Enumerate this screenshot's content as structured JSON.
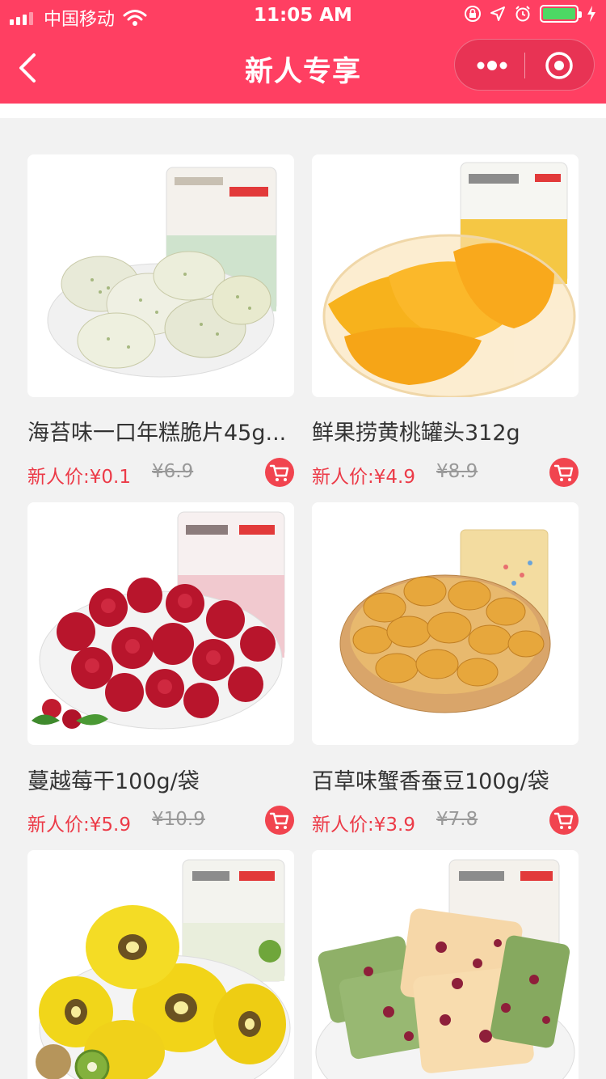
{
  "status_bar": {
    "carrier": "中国移动",
    "time": "11:05 AM",
    "battery_level": 1.0
  },
  "nav": {
    "title": "新人专享",
    "theme_color": "#ff3f62"
  },
  "products": [
    {
      "name": "海苔味一口年糕脆片45g...",
      "new_price": "新人价:¥0.1",
      "old_price": "¥6.9",
      "image": "seaweed-rice-crisps"
    },
    {
      "name": "鲜果捞黄桃罐头312g",
      "new_price": "新人价:¥4.9",
      "old_price": "¥8.9",
      "image": "yellow-peach-can"
    },
    {
      "name": "蔓越莓干100g/袋",
      "new_price": "新人价:¥5.9",
      "old_price": "¥10.9",
      "image": "dried-cranberries"
    },
    {
      "name": "百草味蟹香蚕豆100g/袋",
      "new_price": "新人价:¥3.9",
      "old_price": "¥7.8",
      "image": "crab-flavor-broad-beans"
    },
    {
      "name": "",
      "new_price": "",
      "old_price": "",
      "image": "dried-kiwi"
    },
    {
      "name": "",
      "new_price": "",
      "old_price": "",
      "image": "cranberry-cookies"
    }
  ],
  "colors": {
    "price_red": "#ec3b48",
    "cart_red": "#f1444f",
    "page_bg": "#f2f2f2"
  }
}
